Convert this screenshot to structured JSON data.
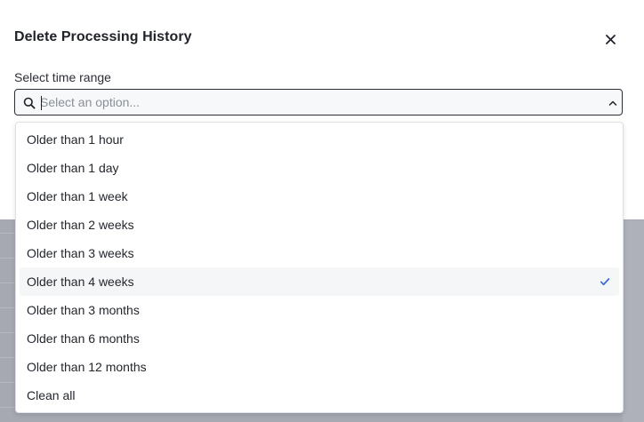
{
  "modal": {
    "title": "Delete Processing History",
    "close_icon": "close-icon"
  },
  "field": {
    "label": "Select time range",
    "placeholder": "Select an option...",
    "value": "",
    "search_icon": "search-icon",
    "chevron_icon": "chevron-up-icon"
  },
  "dropdown": {
    "options": [
      {
        "label": "Older than 1 hour",
        "selected": false
      },
      {
        "label": "Older than 1 day",
        "selected": false
      },
      {
        "label": "Older than 1 week",
        "selected": false
      },
      {
        "label": "Older than 2 weeks",
        "selected": false
      },
      {
        "label": "Older than 3 weeks",
        "selected": false
      },
      {
        "label": "Older than 4 weeks",
        "selected": true
      },
      {
        "label": "Older than 3 months",
        "selected": false
      },
      {
        "label": "Older than 6 months",
        "selected": false
      },
      {
        "label": "Older than 12 months",
        "selected": false
      },
      {
        "label": "Clean all",
        "selected": false
      }
    ],
    "check_icon": "check-icon"
  },
  "colors": {
    "accent": "#3b6fd9",
    "backdrop": "#a6a9b2",
    "text": "#23272e"
  }
}
